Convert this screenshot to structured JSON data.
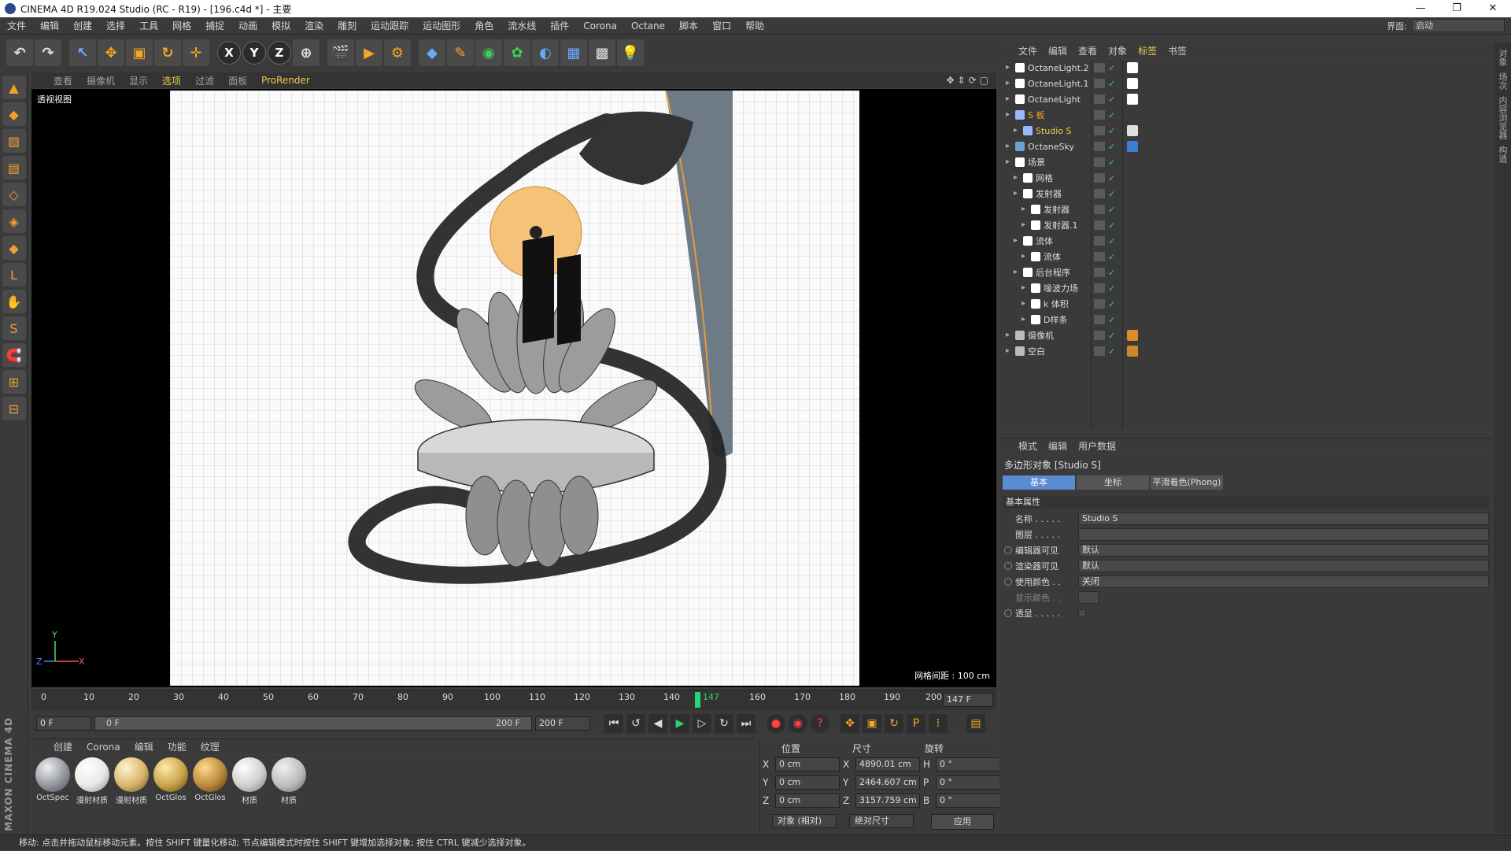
{
  "window": {
    "title": "CINEMA 4D R19.024 Studio (RC - R19) - [196.c4d *] - 主要",
    "buttons": [
      "—",
      "❐",
      "✕"
    ]
  },
  "menu": {
    "items": [
      "文件",
      "编辑",
      "创建",
      "选择",
      "工具",
      "网格",
      "捕捉",
      "动画",
      "模拟",
      "渲染",
      "雕刻",
      "运动跟踪",
      "运动图形",
      "角色",
      "流水线",
      "插件",
      "Corona",
      "Octane",
      "脚本",
      "窗口",
      "帮助"
    ],
    "layout_label": "界面:",
    "layout_value": "启动"
  },
  "viewport": {
    "menu": [
      "查看",
      "摄像机",
      "显示",
      "选项",
      "过滤",
      "面板",
      "ProRender"
    ],
    "label": "透视视图",
    "grid_info": "网格间距 : 100 cm",
    "axis": {
      "x": "X",
      "y": "Y",
      "z": "Z"
    }
  },
  "timeline": {
    "ticks": [
      "0",
      "10",
      "20",
      "30",
      "40",
      "50",
      "60",
      "70",
      "80",
      "90",
      "100",
      "110",
      "120",
      "130",
      "140",
      "147",
      "160",
      "170",
      "180",
      "190",
      "200"
    ],
    "current_frame": "147 F",
    "current_frame_value": 147,
    "start_field": "0 F",
    "range_start": "0 F",
    "range_end": "200 F",
    "end_field": "200 F"
  },
  "materials": {
    "menu": [
      "创建",
      "Corona",
      "编辑",
      "功能",
      "纹理"
    ],
    "items": [
      {
        "label": "OctSpec",
        "color": "#8a8f96"
      },
      {
        "label": "漫射材质",
        "color": "#e8e8e8"
      },
      {
        "label": "漫射材质",
        "color": "#d9b56a"
      },
      {
        "label": "OctGlos",
        "color": "#c9a24a"
      },
      {
        "label": "OctGlos",
        "color": "#b88a3a"
      },
      {
        "label": "材质",
        "color": "#cfcfcf"
      },
      {
        "label": "材质",
        "color": "#bdbdbd"
      }
    ]
  },
  "coords": {
    "headers": [
      "位置",
      "尺寸",
      "旋转"
    ],
    "rows": [
      {
        "axis": "X",
        "pos": "0 cm",
        "size_axis": "X",
        "size": "4890.01 cm",
        "rot_axis": "H",
        "rot": "0 °"
      },
      {
        "axis": "Y",
        "pos": "0 cm",
        "size_axis": "Y",
        "size": "2464.607 cm",
        "rot_axis": "P",
        "rot": "0 °"
      },
      {
        "axis": "Z",
        "pos": "0 cm",
        "size_axis": "Z",
        "size": "3157.759 cm",
        "rot_axis": "B",
        "rot": "0 °"
      }
    ],
    "mode": "对象 (相对)",
    "size_mode": "绝对尺寸",
    "apply": "应用"
  },
  "status": "移动: 点击并拖动鼠标移动元素。按住 SHIFT 键量化移动; 节点编辑模式时按住 SHIFT 键增加选择对象; 按住 CTRL 键减少选择对象。",
  "object_manager": {
    "menu": [
      "文件",
      "编辑",
      "查看",
      "对象",
      "标签",
      "书签"
    ],
    "active_menu": "标签",
    "objects": [
      {
        "name": "OctaneLight.2",
        "indent": 0,
        "style": "",
        "icon_color": "#ffffff",
        "tag_color": "#ffffff"
      },
      {
        "name": "OctaneLight.1",
        "indent": 0,
        "style": "",
        "icon_color": "#ffffff",
        "tag_color": "#ffffff"
      },
      {
        "name": "OctaneLight",
        "indent": 0,
        "style": "",
        "icon_color": "#ffffff",
        "tag_color": "#ffffff"
      },
      {
        "name": "S 板",
        "indent": 0,
        "style": "orange",
        "icon_color": "#9ab8ff",
        "tag_color": ""
      },
      {
        "name": "Studio S",
        "indent": 1,
        "style": "sel",
        "icon_color": "#9ab8ff",
        "tag_color": "#e0e0e0"
      },
      {
        "name": "OctaneSky",
        "indent": 0,
        "style": "",
        "icon_color": "#6fa0d8",
        "tag_color": "#3a7fd0"
      },
      {
        "name": "场景",
        "indent": 0,
        "style": "",
        "icon_color": "#ffffff",
        "tag_color": ""
      },
      {
        "name": "网格",
        "indent": 1,
        "style": "",
        "icon_color": "#ffffff",
        "tag_color": ""
      },
      {
        "name": "发射器",
        "indent": 1,
        "style": "",
        "icon_color": "#ffffff",
        "tag_color": ""
      },
      {
        "name": "发射器",
        "indent": 2,
        "style": "",
        "icon_color": "#ffffff",
        "tag_color": ""
      },
      {
        "name": "发射器.1",
        "indent": 2,
        "style": "",
        "icon_color": "#ffffff",
        "tag_color": ""
      },
      {
        "name": "流体",
        "indent": 1,
        "style": "",
        "icon_color": "#ffffff",
        "tag_color": ""
      },
      {
        "name": "流体",
        "indent": 2,
        "style": "",
        "icon_color": "#ffffff",
        "tag_color": ""
      },
      {
        "name": "后台程序",
        "indent": 1,
        "style": "",
        "icon_color": "#ffffff",
        "tag_color": ""
      },
      {
        "name": "噪波力场",
        "indent": 2,
        "style": "",
        "icon_color": "#ffffff",
        "tag_color": ""
      },
      {
        "name": "k 体积",
        "indent": 2,
        "style": "",
        "icon_color": "#ffffff",
        "tag_color": ""
      },
      {
        "name": "D样条",
        "indent": 2,
        "style": "",
        "icon_color": "#ffffff",
        "tag_color": ""
      },
      {
        "name": "摄像机",
        "indent": 0,
        "style": "",
        "icon_color": "#bbbbbb",
        "tag_color": "#e08a2a"
      },
      {
        "name": "空白",
        "indent": 0,
        "style": "",
        "icon_color": "#bbbbbb",
        "tag_color": "#c88a2a"
      }
    ]
  },
  "attributes": {
    "menu": [
      "模式",
      "编辑",
      "用户数据"
    ],
    "object_title": "多边形对象 [Studio S]",
    "tabs": [
      "基本",
      "坐标",
      "平滑着色(Phong)"
    ],
    "section": "基本属性",
    "props": [
      {
        "label": "名称 . . . . .",
        "value": "Studio S"
      },
      {
        "label": "图层 . . . . .",
        "value": ""
      },
      {
        "label": "编辑器可见",
        "value": "默认"
      },
      {
        "label": "渲染器可见",
        "value": "默认"
      },
      {
        "label": "使用颜色 . .",
        "value": "关闭"
      },
      {
        "label": "显示颜色 . .",
        "value": ""
      },
      {
        "label": "透显 . . . . .",
        "value": ""
      }
    ]
  },
  "right_strip": [
    "对象",
    "场次",
    "内容浏览器",
    "构造"
  ],
  "brand": "MAXON CINEMA 4D"
}
